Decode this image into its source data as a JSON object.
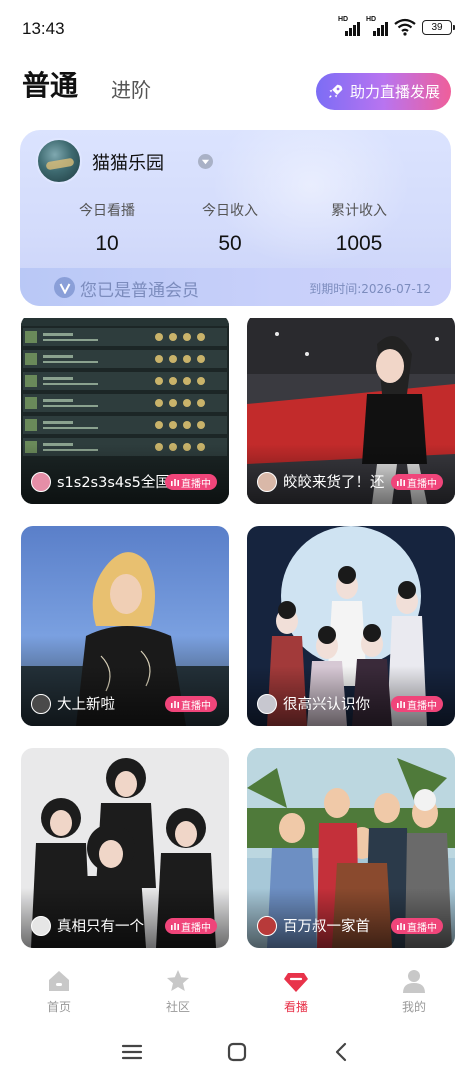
{
  "status_bar": {
    "time": "13:43",
    "battery": "39",
    "signal_label_1": "HD",
    "signal_label_2": "HD"
  },
  "header": {
    "tab_primary": "普通",
    "tab_secondary": "进阶",
    "boost_button": "助力直播发展"
  },
  "member": {
    "nickname": "猫猫乐园",
    "stats": [
      {
        "label": "今日看播",
        "value": "10"
      },
      {
        "label": "今日收入",
        "value": "50"
      },
      {
        "label": "累计收入",
        "value": "1005"
      }
    ],
    "status_text": "您已是普通会员",
    "expire_text": "到期时间:2026-07-12"
  },
  "feed": [
    {
      "title": "s1s2s3s4s5全国",
      "live_label": "直播中"
    },
    {
      "title": "皎皎来货了！还",
      "live_label": "直播中"
    },
    {
      "title": "大上新啦",
      "live_label": "直播中"
    },
    {
      "title": "很高兴认识你",
      "live_label": "直播中"
    },
    {
      "title": "真相只有一个",
      "live_label": "直播中"
    },
    {
      "title": "百万叔一家首",
      "live_label": "直播中"
    }
  ],
  "nav": {
    "items": [
      {
        "label": "首页",
        "icon": "home-icon"
      },
      {
        "label": "社区",
        "icon": "star-icon"
      },
      {
        "label": "看播",
        "icon": "diamond-icon",
        "active": true
      },
      {
        "label": "我的",
        "icon": "person-icon"
      }
    ]
  },
  "colors": {
    "accent": "#e8334a",
    "live_badge": "#f0457a",
    "card_bg": "#d3dbfb",
    "boost_start": "#7c6df5",
    "boost_end": "#ef5f9a"
  }
}
